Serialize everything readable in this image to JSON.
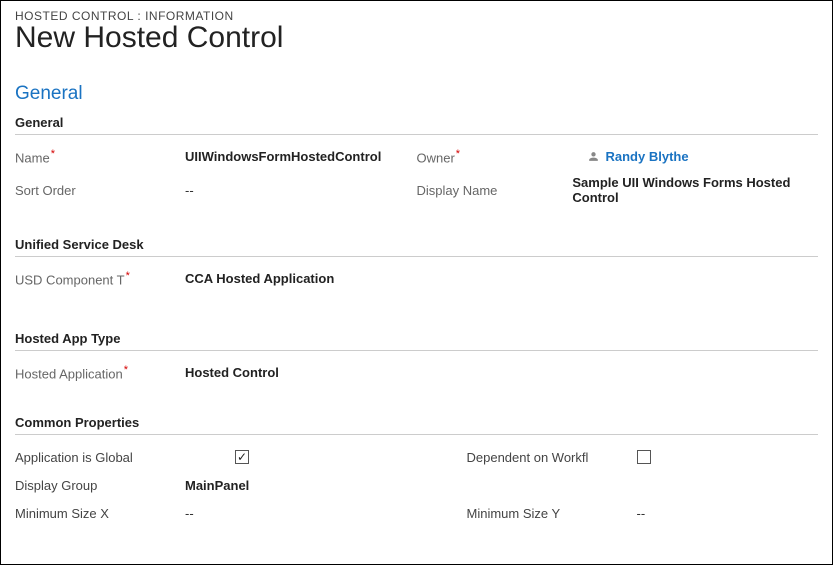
{
  "breadcrumb": "HOSTED CONTROL : INFORMATION",
  "page_title": "New Hosted Control",
  "section_general": "General",
  "sub_general": "General",
  "fields": {
    "name_label": "Name",
    "name_value": "UIIWindowsFormHostedControl",
    "owner_label": "Owner",
    "owner_value": "Randy Blythe",
    "sort_order_label": "Sort Order",
    "sort_order_value": "--",
    "display_name_label": "Display Name",
    "display_name_value": "Sample UII Windows Forms Hosted Control"
  },
  "sub_usd": "Unified Service Desk",
  "usd": {
    "component_label": "USD Component T",
    "component_value": "CCA Hosted Application"
  },
  "sub_hosted_app": "Hosted App Type",
  "hosted_app": {
    "label": "Hosted Application",
    "value": "Hosted Control"
  },
  "sub_common": "Common Properties",
  "common": {
    "app_global_label": "Application is Global",
    "app_global_checked": "✓",
    "dependent_label": "Dependent on Workfl",
    "display_group_label": "Display Group",
    "display_group_value": "MainPanel",
    "min_x_label": "Minimum Size X",
    "min_x_value": "--",
    "min_y_label": "Minimum Size Y",
    "min_y_value": "--"
  }
}
